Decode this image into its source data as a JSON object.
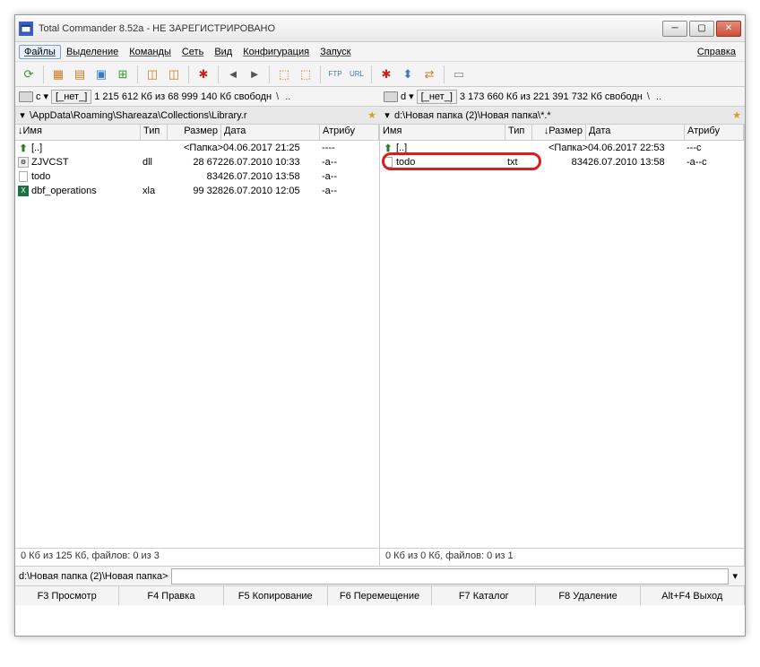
{
  "window": {
    "title": "Total Commander 8.52a - НЕ ЗАРЕГИСТРИРОВАНО"
  },
  "menu": {
    "files": "Файлы",
    "select": "Выделение",
    "commands": "Команды",
    "net": "Сеть",
    "view": "Вид",
    "config": "Конфигурация",
    "start": "Запуск",
    "help": "Справка"
  },
  "drive": {
    "left_letter": "c",
    "left_none": "[_нет_]",
    "left_free": "1 215 612 Кб из 68 999 140 Кб свободн",
    "right_letter": "d",
    "right_none": "[_нет_]",
    "right_free": "3 173 660 Кб из 221 391 732 Кб свободн",
    "back": "\\",
    "up": ".."
  },
  "path": {
    "left": "\\AppData\\Roaming\\Shareaza\\Collections\\Library.r",
    "right": "d:\\Новая папка (2)\\Новая папка\\*.*"
  },
  "columns": {
    "name": "Имя",
    "ext": "Тип",
    "size": "Размер",
    "date": "Дата",
    "attr": "Атрибу"
  },
  "left_files": [
    {
      "name": "[..]",
      "ext": "",
      "size": "<Папка>",
      "date": "04.06.2017 21:25",
      "attr": "----",
      "icon": "up"
    },
    {
      "name": "ZJVCST",
      "ext": "dll",
      "size": "28 672",
      "date": "26.07.2010 10:33",
      "attr": "-a--",
      "icon": "dll"
    },
    {
      "name": "todo",
      "ext": "",
      "size": "834",
      "date": "26.07.2010 13:58",
      "attr": "-a--",
      "icon": "txt"
    },
    {
      "name": "dbf_operations",
      "ext": "xla",
      "size": "99 328",
      "date": "26.07.2010 12:05",
      "attr": "-a--",
      "icon": "xl"
    }
  ],
  "right_files": [
    {
      "name": "[..]",
      "ext": "",
      "size": "<Папка>",
      "date": "04.06.2017 22:53",
      "attr": "---с",
      "icon": "up"
    },
    {
      "name": "todo",
      "ext": "txt",
      "size": "834",
      "date": "26.07.2010 13:58",
      "attr": "-a--с",
      "icon": "txt"
    }
  ],
  "status": {
    "left": "0 Кб из 125 Кб, файлов: 0 из 3",
    "right": "0 Кб из 0 Кб, файлов: 0 из 1"
  },
  "cmdline": {
    "prompt": "d:\\Новая папка (2)\\Новая папка>"
  },
  "fkeys": {
    "f3": "F3 Просмотр",
    "f4": "F4 Правка",
    "f5": "F5 Копирование",
    "f6": "F6 Перемещение",
    "f7": "F7 Каталог",
    "f8": "F8 Удаление",
    "altf4": "Alt+F4 Выход"
  }
}
